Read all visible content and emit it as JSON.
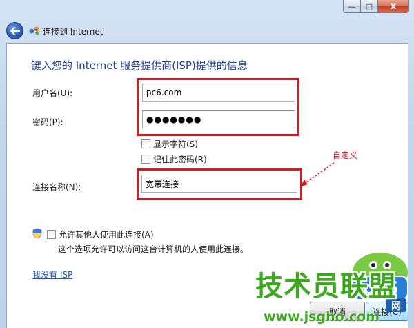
{
  "window": {
    "title": "连接到 Internet",
    "controls": {
      "minimize": "—",
      "maximize": "□",
      "close": "X"
    }
  },
  "page": {
    "heading": "键入您的 Internet 服务提供商(ISP)提供的信息"
  },
  "form": {
    "username_label": "用户名(U):",
    "username_value": "pc6.com",
    "password_label": "密码(P):",
    "password_value": "●●●●●●●",
    "show_chars_label": "显示字符(S)",
    "show_chars_checked": false,
    "remember_label": "记住此密码(R)",
    "remember_checked": false,
    "connection_name_label": "连接名称(N):",
    "connection_name_value": "宽带连接",
    "allow_others_label": "允许其他人使用此连接(A)",
    "allow_others_checked": false,
    "allow_others_note": "这个选项允许可以访问这台计算机的人使用此连接。",
    "no_isp_link": "我没有 ISP"
  },
  "annotation": {
    "text": "自定义",
    "color": "#d11b25"
  },
  "buttons": {
    "create": "连接(C)",
    "cancel": "取消"
  },
  "watermark": {
    "text": "技术员联盟",
    "url": "www.jsgho.com",
    "badge": "pc6",
    "badge_sub": "网"
  },
  "colors": {
    "heading": "#1f3f93",
    "highlight": "#d11b25",
    "link": "#1a56c0"
  }
}
